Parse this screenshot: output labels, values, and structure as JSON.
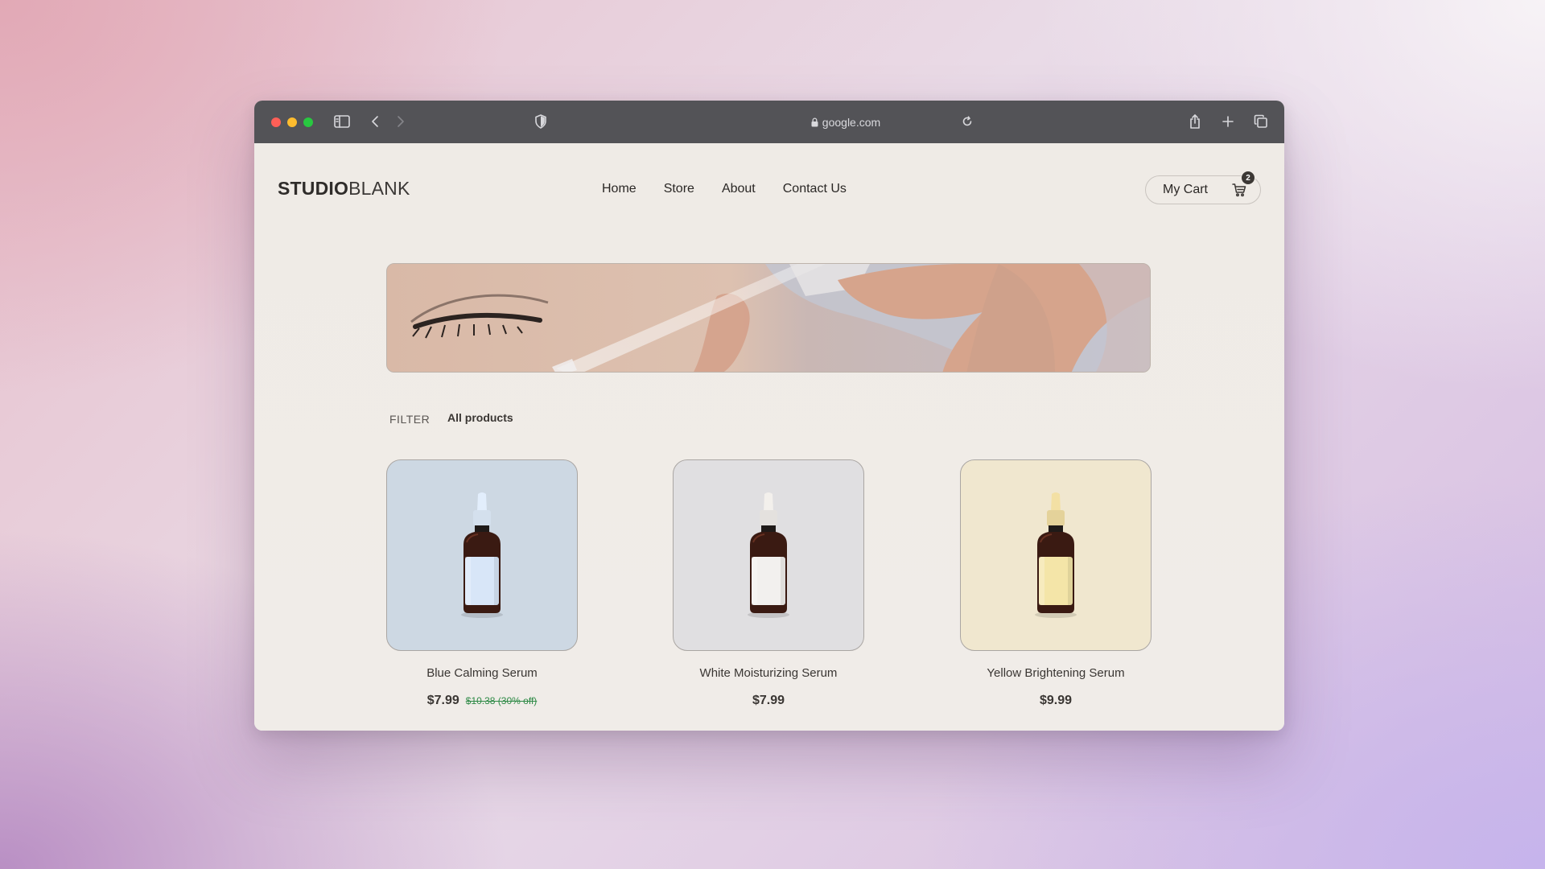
{
  "browser": {
    "url": "google.com"
  },
  "header": {
    "logo_bold": "STUDIO",
    "logo_light": "BLANK",
    "nav": [
      {
        "label": "Home"
      },
      {
        "label": "Store"
      },
      {
        "label": "About"
      },
      {
        "label": "Contact Us"
      }
    ],
    "cart_label": "My Cart",
    "cart_count": "2"
  },
  "filter": {
    "label": "FILTER",
    "value": "All products"
  },
  "products": [
    {
      "name": "Blue Calming Serum",
      "price": "$7.99",
      "old_price": "$10.38 (30% off)",
      "label_color": "#d8e6f8",
      "cap_color": "#e2eefc",
      "card_color": "#cdd8e3"
    },
    {
      "name": "White Moisturizing Serum",
      "price": "$7.99",
      "label_color": "#f2f0ee",
      "cap_color": "#f3f0ec",
      "card_color": "#e0dfe1"
    },
    {
      "name": "Yellow Brightening Serum",
      "price": "$9.99",
      "label_color": "#f4e5a8",
      "cap_color": "#f3e0a4",
      "card_color": "#f0e7cf"
    }
  ]
}
